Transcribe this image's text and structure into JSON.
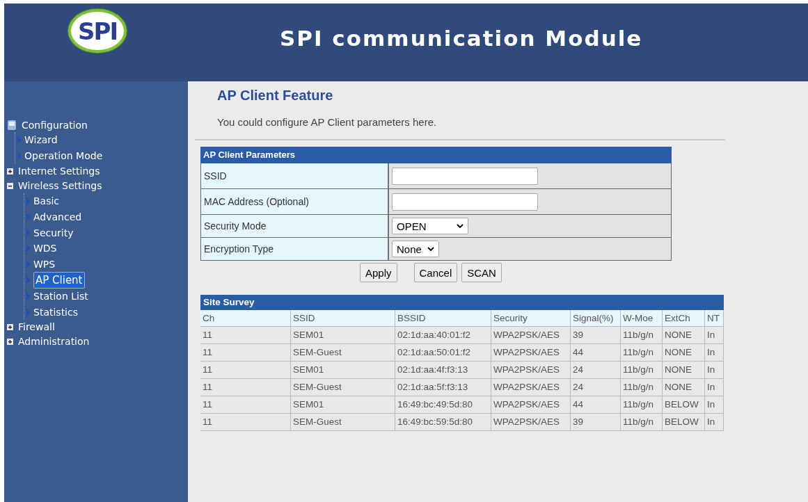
{
  "header": {
    "logo": "SPI",
    "title": "SPI communication Module"
  },
  "sidebar": {
    "items": [
      {
        "label": "Configuration",
        "kind": "root",
        "children": [
          {
            "label": "Wizard",
            "kind": "page",
            "selected": false
          },
          {
            "label": "Operation Mode",
            "kind": "page",
            "selected": false
          }
        ]
      },
      {
        "label": "Internet Settings",
        "kind": "folder",
        "expanded": false
      },
      {
        "label": "Wireless Settings",
        "kind": "folder",
        "expanded": true,
        "children": [
          {
            "label": "Basic",
            "kind": "page",
            "selected": false
          },
          {
            "label": "Advanced",
            "kind": "page",
            "selected": false
          },
          {
            "label": "Security",
            "kind": "page",
            "selected": false
          },
          {
            "label": "WDS",
            "kind": "page",
            "selected": false
          },
          {
            "label": "WPS",
            "kind": "page",
            "selected": false
          },
          {
            "label": "AP Client",
            "kind": "page",
            "selected": true
          },
          {
            "label": "Station List",
            "kind": "page",
            "selected": false
          },
          {
            "label": "Statistics",
            "kind": "page",
            "selected": false
          }
        ]
      },
      {
        "label": "Firewall",
        "kind": "folder",
        "expanded": false
      },
      {
        "label": "Administration",
        "kind": "folder",
        "expanded": false
      }
    ]
  },
  "page": {
    "title": "AP Client Feature",
    "description": "You could configure AP Client parameters here."
  },
  "parameters": {
    "title": "AP Client Parameters",
    "rows": [
      {
        "label": "SSID",
        "kind": "text"
      },
      {
        "label": "MAC Address (Optional)",
        "kind": "text"
      },
      {
        "label": "Security Mode",
        "kind": "select",
        "value": "OPEN"
      },
      {
        "label": "Encryption Type",
        "kind": "select",
        "value": "None"
      }
    ]
  },
  "buttons": [
    "Apply",
    "Cancel",
    "SCAN"
  ],
  "site_survey": {
    "title": "Site Survey",
    "columns": [
      "Ch",
      "SSID",
      "BSSID",
      "Security",
      "Signal(%)",
      "W-Moe",
      "ExtCh",
      "NT"
    ],
    "rows": [
      [
        "11",
        "SEM01",
        "02:1d:aa:40:01:f2",
        "WPA2PSK/AES",
        "39",
        "11b/g/n",
        "NONE",
        "In"
      ],
      [
        "11",
        "SEM-Guest",
        "02:1d:aa:50:01:f2",
        "WPA2PSK/AES",
        "44",
        "11b/g/n",
        "NONE",
        "In"
      ],
      [
        "11",
        "SEM01",
        "02:1d:aa:4f:f3:13",
        "WPA2PSK/AES",
        "24",
        "11b/g/n",
        "NONE",
        "In"
      ],
      [
        "11",
        "SEM-Guest",
        "02:1d:aa:5f:f3:13",
        "WPA2PSK/AES",
        "24",
        "11b/g/n",
        "NONE",
        "In"
      ],
      [
        "11",
        "SEM01",
        "16:49:bc:49:5d:80",
        "WPA2PSK/AES",
        "44",
        "11b/g/n",
        "BELOW",
        "In"
      ],
      [
        "11",
        "SEM-Guest",
        "16:49:bc:59:5d:80",
        "WPA2PSK/AES",
        "39",
        "11b/g/n",
        "BELOW",
        "In"
      ]
    ]
  }
}
